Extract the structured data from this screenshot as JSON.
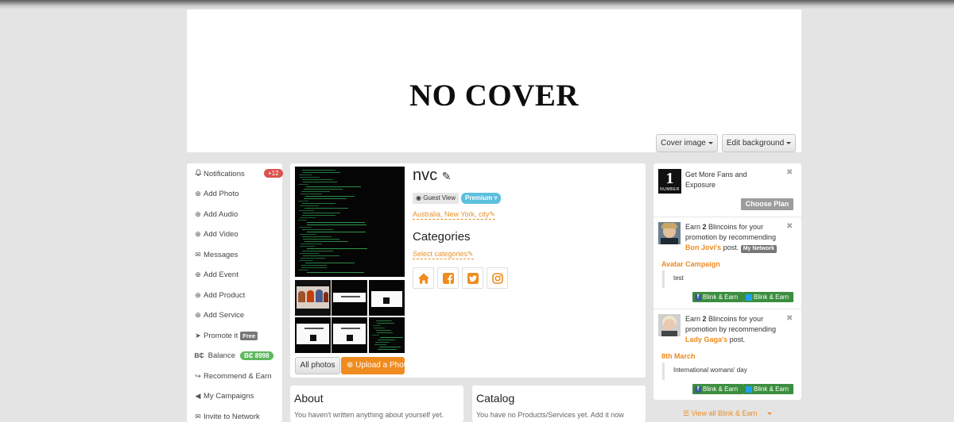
{
  "cover": {
    "placeholder_text": "NO COVER",
    "cover_image_label": "Cover image",
    "edit_background_label": "Edit background"
  },
  "sidebar": {
    "items": [
      {
        "label": "Notifications",
        "icon": "bell-icon",
        "badge": "+12"
      },
      {
        "label": "Add Photo",
        "icon": "plus-circle-icon"
      },
      {
        "label": "Add Audio",
        "icon": "plus-circle-icon"
      },
      {
        "label": "Add Video",
        "icon": "plus-circle-icon"
      },
      {
        "label": "Messages",
        "icon": "envelope-icon"
      },
      {
        "label": "Add Event",
        "icon": "plus-circle-icon"
      },
      {
        "label": "Add Product",
        "icon": "plus-circle-icon"
      },
      {
        "label": "Add Service",
        "icon": "plus-circle-icon"
      },
      {
        "label": "Promote it",
        "icon": "rocket-icon",
        "badge": "Free"
      },
      {
        "label": "Balance",
        "icon": "bc-icon",
        "icon_text": "B₵",
        "badge": "B₵ 8998"
      },
      {
        "label": "Recommend & Earn",
        "icon": "share-icon"
      },
      {
        "label": "My Campaigns",
        "icon": "bullhorn-icon"
      },
      {
        "label": "Invite to Network",
        "icon": "envelope-icon"
      }
    ]
  },
  "profile": {
    "name": "nvc",
    "guest_view_label": "Guest View",
    "premium_label": "Premium",
    "location": "Australia, New York, city",
    "categories_title": "Categories",
    "select_categories": "Select categories",
    "all_photos_label": "All photos",
    "upload_photo_label": "Upload a Photo",
    "social": [
      "home-icon",
      "facebook-icon",
      "twitter-icon",
      "instagram-icon"
    ]
  },
  "about": {
    "title": "About",
    "text": "You haven't written anything about yourself yet."
  },
  "catalog": {
    "title": "Catalog",
    "text": "You have no Products/Services yet. Add it now"
  },
  "right_panel": {
    "promo": {
      "logo_number": "1",
      "logo_text": "NUMBER",
      "text": "Get More Fans and Exposure",
      "button": "Choose Plan"
    },
    "earn": [
      {
        "pre": "Earn ",
        "amount": "2",
        "mid": " Blincoins for your promotion by recommending ",
        "artist": "Bon Jovi's",
        "post": " post.",
        "network_badge": "My Network",
        "campaign": "Avatar Campaign",
        "quote": "test",
        "fb_label": "Blink & Earn",
        "tw_label": "Blink & Earn"
      },
      {
        "pre": "Earn ",
        "amount": "2",
        "mid": " Blincoins for your promotion by recommending ",
        "artist": "Lady Gaga's",
        "post": " post.",
        "campaign": "8th March",
        "quote": "International womans' day",
        "fb_label": "Blink & Earn",
        "tw_label": "Blink & Earn"
      }
    ],
    "view_all": "View all Blink & Earn"
  },
  "colors": {
    "accent": "#ef8b1f",
    "badge_red": "#d9534f",
    "badge_green": "#5cb85c",
    "premium": "#5bc0de",
    "earn_button": "#3b8e3e"
  }
}
